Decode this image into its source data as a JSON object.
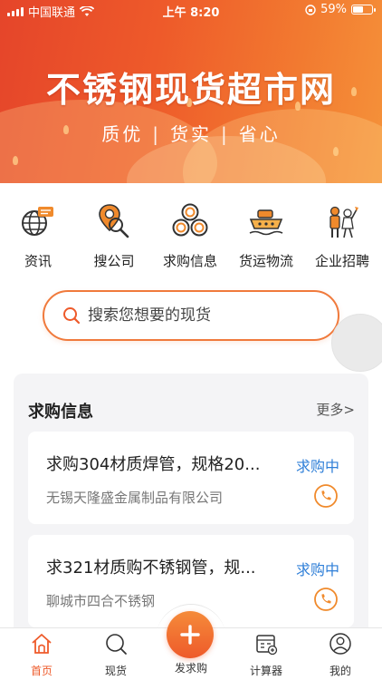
{
  "status_bar": {
    "carrier": "中国联通",
    "time": "上午 8:20",
    "battery": "59%",
    "battery_level": 0.59
  },
  "banner": {
    "title": "不锈钢现货超市网",
    "slogans": [
      "质优",
      "货实",
      "省心"
    ],
    "separator": "|"
  },
  "quick_nav": [
    {
      "label": "资讯",
      "icon": "news-globe-icon"
    },
    {
      "label": "搜公司",
      "icon": "company-search-icon"
    },
    {
      "label": "求购信息",
      "icon": "purchase-rings-icon"
    },
    {
      "label": "货运物流",
      "icon": "ship-icon"
    },
    {
      "label": "企业招聘",
      "icon": "recruit-icon"
    }
  ],
  "search": {
    "placeholder": "搜索您想要的现货"
  },
  "requests_panel": {
    "title": "求购信息",
    "more": "更多>",
    "items": [
      {
        "title": "求购304材质焊管，规格20...",
        "status": "求购中",
        "company": "无锡天隆盛金属制品有限公司"
      },
      {
        "title": "求321材质购不锈钢管，规...",
        "status": "求购中",
        "company": "聊城市四合不锈钢"
      }
    ]
  },
  "tab_bar": {
    "items": [
      {
        "label": "首页",
        "icon": "home-icon",
        "active": true
      },
      {
        "label": "现货",
        "icon": "search-icon",
        "active": false
      },
      {
        "label": "发求购",
        "icon": "plus-icon",
        "active": false
      },
      {
        "label": "计算器",
        "icon": "calculator-icon",
        "active": false
      },
      {
        "label": "我的",
        "icon": "user-icon",
        "active": false
      }
    ]
  },
  "colors": {
    "accent": "#ee5a2a",
    "status_blue": "#2f7fd8",
    "phone_orange": "#f08a2c"
  }
}
